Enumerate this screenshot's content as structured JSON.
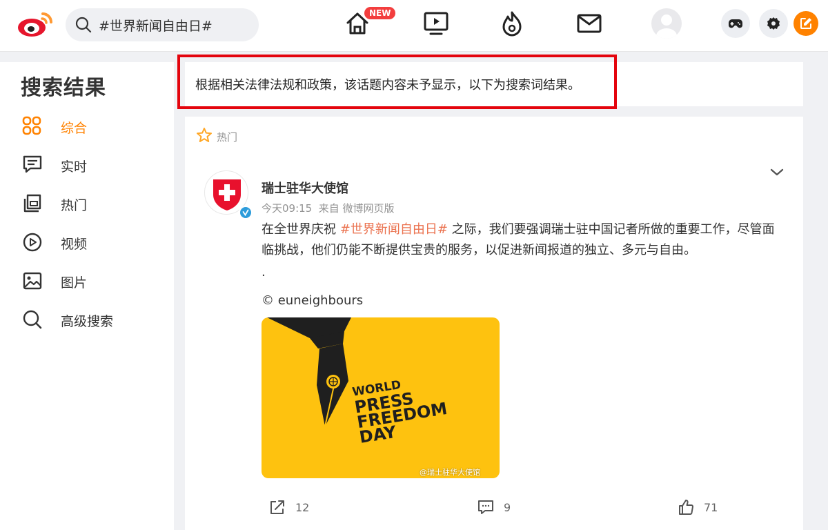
{
  "header": {
    "search_value": "#世界新闻自由日#",
    "new_badge": "NEW"
  },
  "sidebar": {
    "title": "搜索结果",
    "items": [
      {
        "label": "综合",
        "icon": "grid-icon",
        "active": true
      },
      {
        "label": "实时",
        "icon": "message-icon"
      },
      {
        "label": "热门",
        "icon": "doc-icon"
      },
      {
        "label": "视频",
        "icon": "play-circle-icon"
      },
      {
        "label": "图片",
        "icon": "image-icon"
      },
      {
        "label": "高级搜索",
        "icon": "search-icon"
      }
    ]
  },
  "notice": "根据相关法律法规和政策，该话题内容未予显示，以下为搜索词结果。",
  "feed": {
    "section_label": "热门",
    "post": {
      "author": "瑞士驻华大使馆",
      "time": "今天09:15",
      "source": "来自 微博网页版",
      "text_before": "在全世界庆祝 ",
      "hashtag": "#世界新闻自由日#",
      "text_after": " 之际，我们要强调瑞士驻中国记者所做的重要工作，尽管面临挑战，他们仍能不断提供宝贵的服务，以促进新闻报道的独立、多元与自由。",
      "dot": ".",
      "credit": "© euneighbours",
      "image_lines": [
        "WORLD",
        "PRESS",
        "FREEDOM",
        "DAY"
      ],
      "image_watermark": "@瑞士驻华大使馆",
      "reposts": "12",
      "comments": "9",
      "likes": "71"
    }
  },
  "colors": {
    "accent": "#ff8200",
    "hashtag": "#eb7350",
    "notice_border": "#e4040d",
    "image_bg": "#fec20f"
  }
}
